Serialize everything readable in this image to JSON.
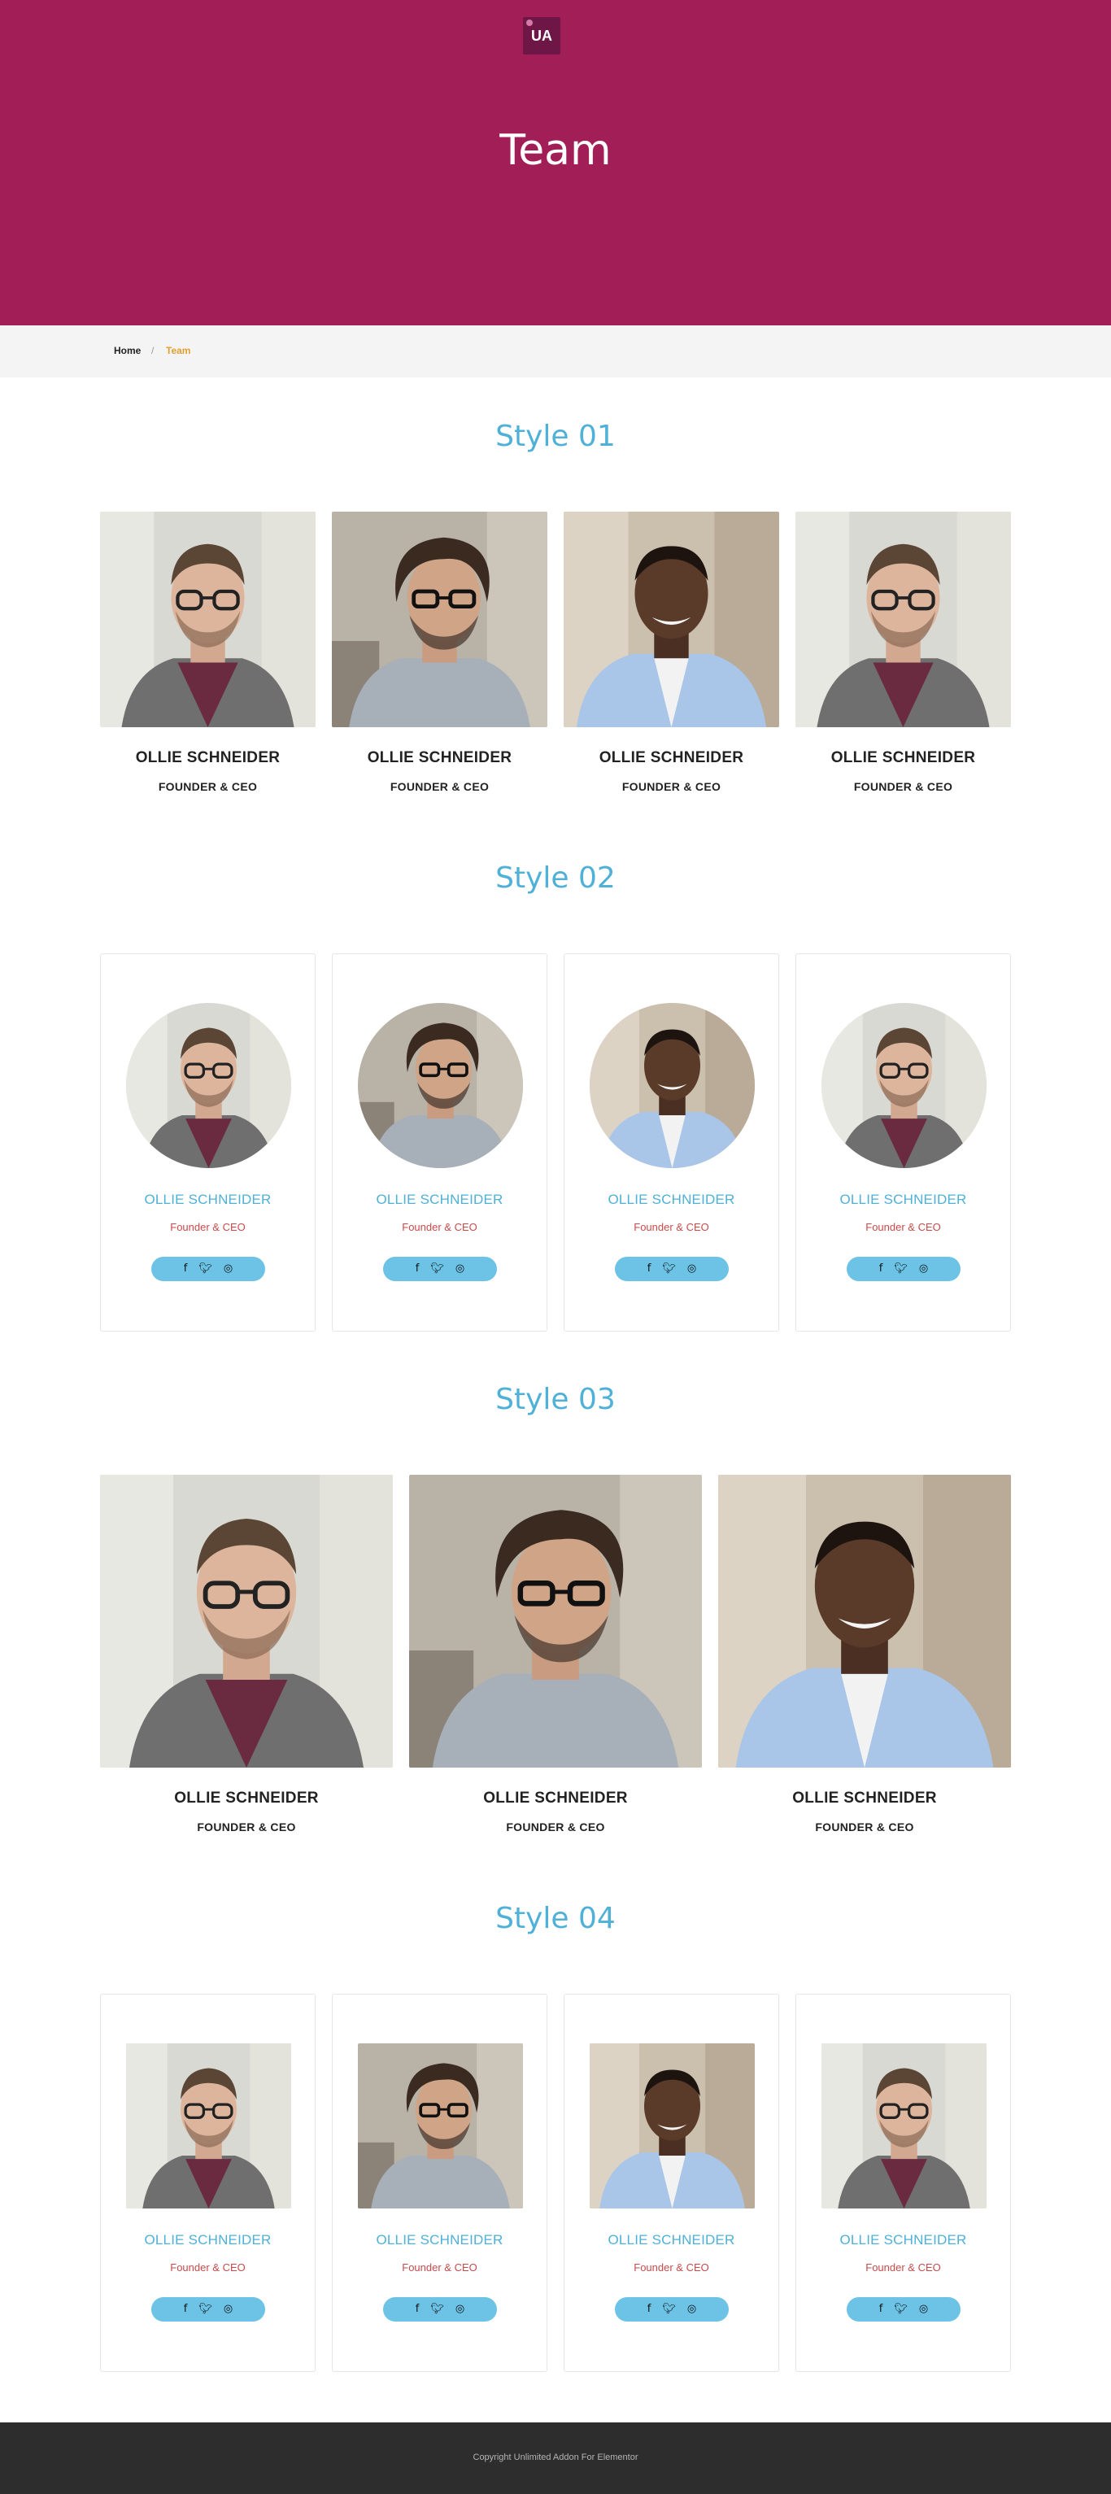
{
  "header": {
    "logo_text": "UA",
    "title": "Team"
  },
  "breadcrumb": {
    "home": "Home",
    "separator": "/",
    "current": "Team"
  },
  "member": {
    "name": "OLLIE SCHNEIDER",
    "role": "FOUNDER & CEO",
    "name_card": "OLLIE SCHNEIDER",
    "role_card": "Founder & CEO"
  },
  "sections": {
    "style1": "Style 01",
    "style2": "Style 02",
    "style3": "Style 03",
    "style4": "Style 04"
  },
  "social_icons": [
    "facebook-icon",
    "twitter-icon",
    "instagram-icon"
  ],
  "photos": [
    "person-glasses-beard",
    "person-curly-hair-glasses",
    "person-smiling-blue-shirt",
    "person-glasses-beard"
  ],
  "footer": {
    "copyright": "Copyright Unlimited Addon For Elementor"
  },
  "colors": {
    "hero": "#a11f56",
    "accent_blue": "#4fb0d8",
    "social_pill": "#6cc3e6",
    "role_red": "#c84a4a",
    "breadcrumb_active": "#e0a030",
    "footer": "#2d2d2d"
  }
}
